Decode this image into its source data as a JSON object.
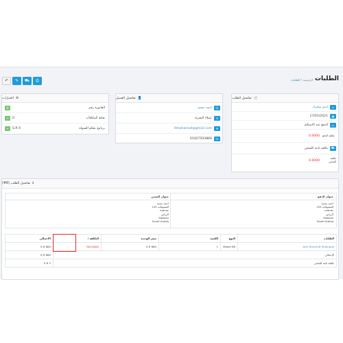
{
  "header": {
    "title": "الطلبات",
    "breadcrumb": [
      "الطلبات",
      "الرئيسية"
    ]
  },
  "actions": {
    "print_icon": "print-icon",
    "shipping_icon": "truck-icon",
    "edit_icon": "pencil-icon",
    "back_icon": "reply-icon"
  },
  "order_details": {
    "title": "تفاصيل الطلب",
    "store": "اسم متجرك",
    "date": "17/01/2021",
    "payment_method": "الدفع عند الاستلام",
    "payment_cost_label": "تكلفة الدفع",
    "payment_cost_value": "0.0000",
    "shipping_method": "تكلفة ثابتة للشحن",
    "shipping_cost_label": "تكلفة الشحن",
    "shipping_cost_value": "0.0000"
  },
  "customer_details": {
    "title": "تفاصيل العميل",
    "name": "احمد محمد",
    "group": "عملاء التجزئة",
    "email": "Hmohamed@gmail.com",
    "phone": "01027503866"
  },
  "options": {
    "title": "الخيارات",
    "invoice": "الفاتورة رقم",
    "reward": "نقاط المكافآت",
    "reward_value": "0",
    "affiliate": "برنامج نظام العمولة",
    "affiliate_value": "S.R 0"
  },
  "order_items": {
    "title": "تفاصيل الطلب (8#)",
    "payment_address_title": "عنوان الدفع",
    "shipping_address_title": "عنوان الشحن",
    "payment_address": [
      "احمد محمد",
      "المشوقات 155",
      "mdnac",
      "الرياض",
      "Makkah",
      "Saudi Arabia"
    ],
    "shipping_address": [
      "احمد محمد",
      "المشوقات 155",
      "mdnac",
      "الرياض",
      "Makkah",
      "Saudi Arabia"
    ],
    "columns": [
      "الطلبات",
      "النوع",
      "الكمية",
      "سعر الوحدة",
      "التكلفة",
      "الاجمالي"
    ],
    "rows": [
      {
        "product": "Anti Dandruff Shampoo",
        "model": "Model 88",
        "qty": "1",
        "unit_price": "S.R 680",
        "cost": "340.0000",
        "total": "S.R 680"
      }
    ],
    "subtotal_label": "الإجمالي",
    "subtotal_value": "S.R 680",
    "shipping_label": "تكلفة ثابتة للشحن",
    "shipping_value": "S.R 5"
  }
}
